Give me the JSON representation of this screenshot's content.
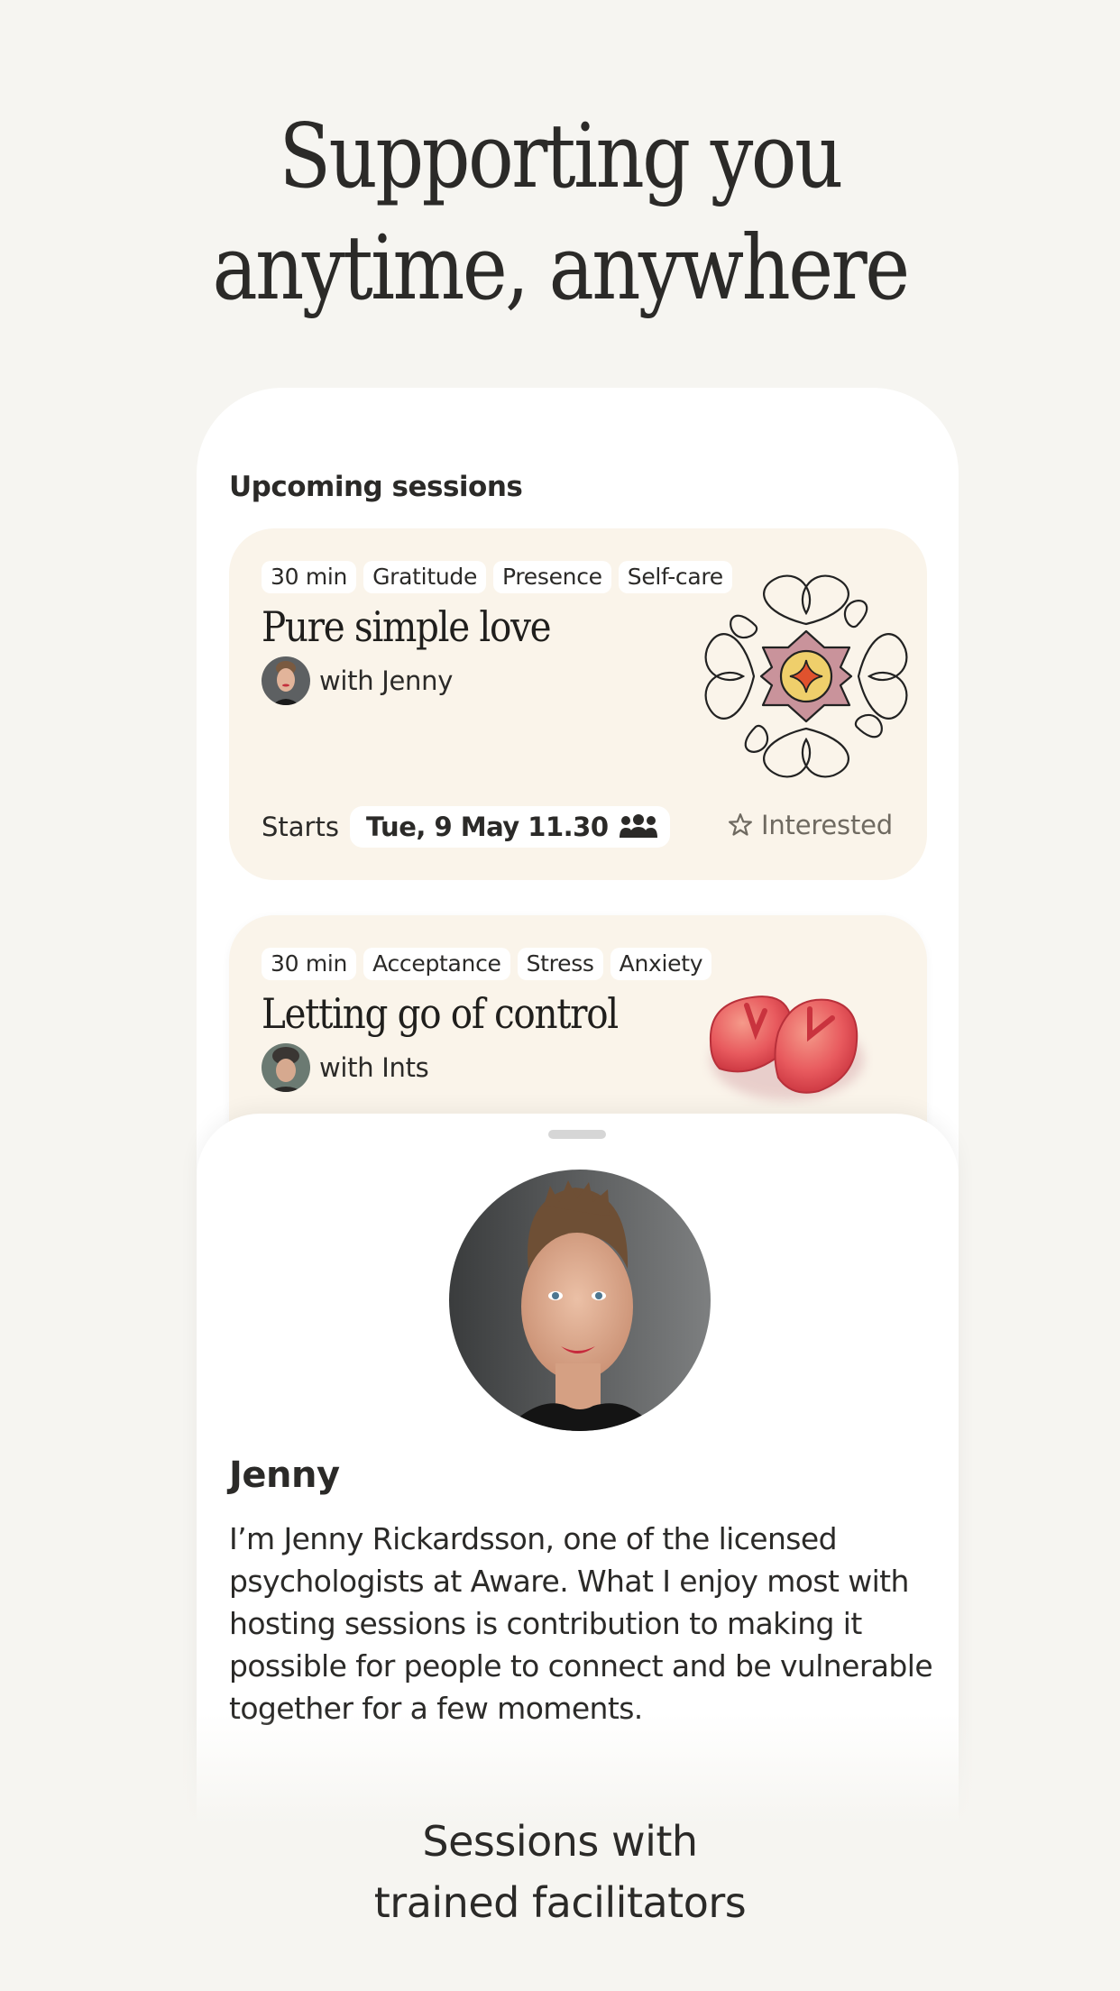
{
  "headline": {
    "line1": "Supporting you",
    "line2": "anytime, anywhere"
  },
  "upcoming": {
    "section_title": "Upcoming sessions",
    "sessions": [
      {
        "tags": [
          "30 min",
          "Gratitude",
          "Presence",
          "Self-care"
        ],
        "title": "Pure simple love",
        "host": "with Jenny",
        "starts_label": "Starts",
        "date": "Tue, 9 May 11.30",
        "date_icon": "group-icon",
        "interested_label": "Interested",
        "interested_icon": "star-outline-icon",
        "illustration": "mandala-illustration"
      },
      {
        "tags": [
          "30 min",
          "Acceptance",
          "Stress",
          "Anxiety"
        ],
        "title": "Letting go of control",
        "host": "with Ints",
        "illustration": "flip-flops-illustration"
      }
    ]
  },
  "facilitator_sheet": {
    "name": "Jenny",
    "bio": "I’m Jenny Rickardsson, one of the licensed psychologists at Aware. What I enjoy most with hosting sessions is contribution to making it possible for people to connect and be vulnerable together for a few moments."
  },
  "tagline": {
    "line1": "Sessions with",
    "line2": "trained facilitators"
  },
  "colors": {
    "background": "#F6F5F1",
    "card": "#FAF4EA",
    "text": "#2B2A28",
    "muted": "#6F6A61",
    "mandala_pink": "#C9939B",
    "mandala_yellow": "#EFCF6B",
    "mandala_star": "#E0522E",
    "flipflop_red": "#E34B52"
  }
}
